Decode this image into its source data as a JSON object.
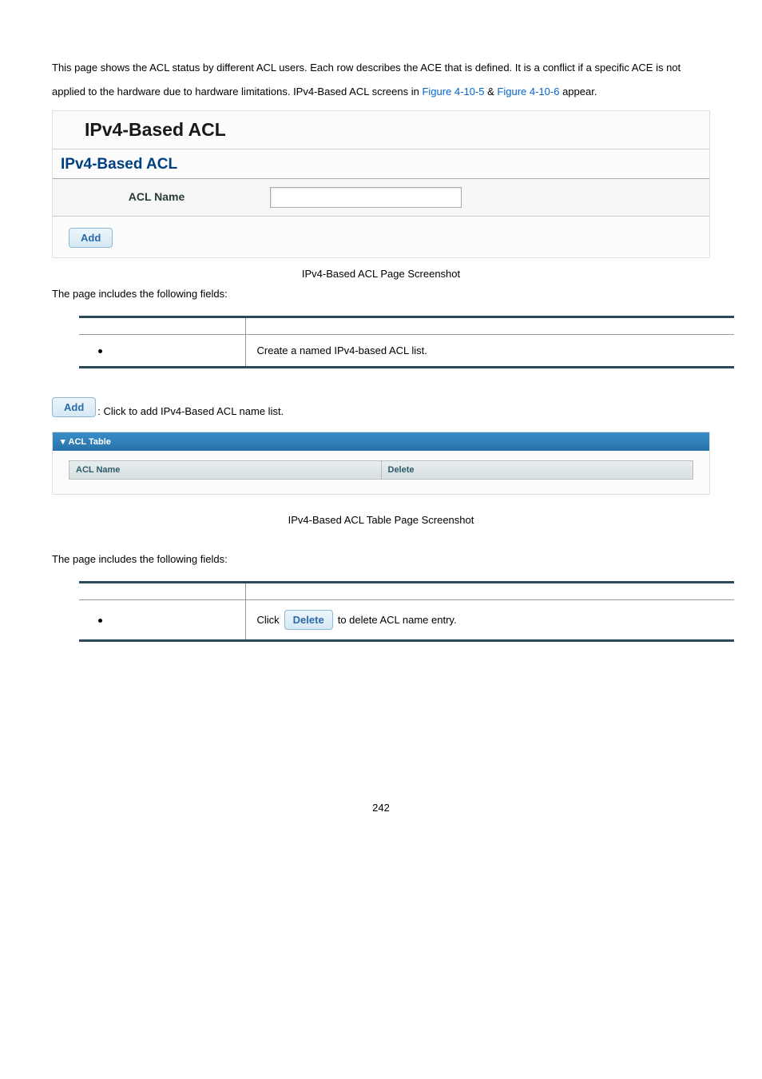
{
  "intro": {
    "part1": "This page shows the ACL status by different ACL users. Each row describes the ACE that is defined. It is a conflict if a specific ACE is not applied to the hardware due to hardware limitations. IPv4-Based ACL screens in ",
    "link1": "Figure 4-10-5",
    "amp": " & ",
    "link2": "Figure 4-10-6",
    "part2": " appear."
  },
  "panel": {
    "title": "IPv4-Based ACL",
    "section": "IPv4-Based ACL",
    "acl_name_label": "ACL Name",
    "add_label": "Add"
  },
  "caption1": "IPv4-Based ACL Page Screenshot",
  "fields_intro": "The page includes the following fields:",
  "table1": {
    "desc": "Create a named IPv4-based ACL list."
  },
  "add_instruction": {
    "btn": "Add",
    "text": ": Click to add IPv4-Based ACL name list."
  },
  "acl_table": {
    "header": "ACL Table",
    "col1": "ACL Name",
    "col2": "Delete"
  },
  "caption2": "IPv4-Based ACL Table Page Screenshot",
  "fields_intro2": "The page includes the following fields:",
  "table2": {
    "click": "Click ",
    "delete_btn": "Delete",
    "after": " to delete ACL name entry."
  },
  "page_number": "242"
}
